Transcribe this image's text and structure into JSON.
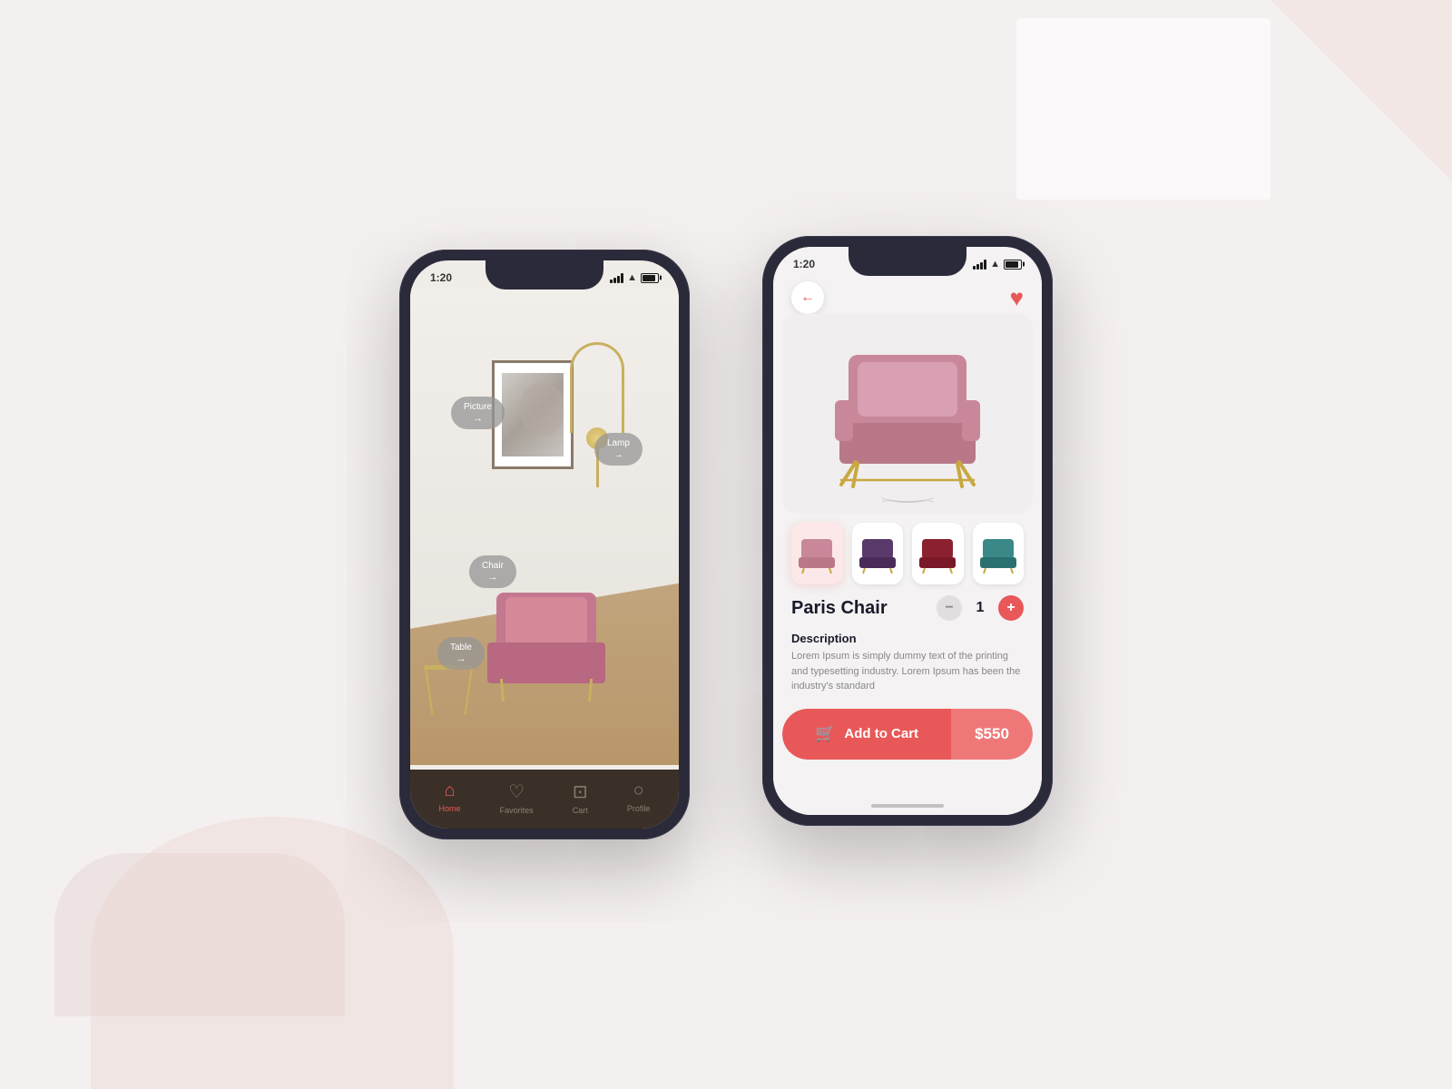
{
  "background": {
    "color": "#f5f0f0"
  },
  "phone1": {
    "status_bar": {
      "time": "1:20",
      "location_icon": "▲"
    },
    "ar_tags": [
      {
        "label": "Picture",
        "id": "picture"
      },
      {
        "label": "Lamp",
        "id": "lamp"
      },
      {
        "label": "Chair",
        "id": "chair"
      },
      {
        "label": "Table",
        "id": "table"
      }
    ],
    "nav_items": [
      {
        "label": "Home",
        "active": true,
        "icon": "⌂"
      },
      {
        "label": "Favorites",
        "active": false,
        "icon": "♡"
      },
      {
        "label": "Cart",
        "active": false,
        "icon": "🛒"
      },
      {
        "label": "Profile",
        "active": false,
        "icon": "👤"
      }
    ]
  },
  "phone2": {
    "status_bar": {
      "time": "1:20",
      "location_icon": "▲"
    },
    "header": {
      "back_label": "←",
      "heart_label": "♥"
    },
    "product": {
      "name": "Paris Chair",
      "description_title": "Description",
      "description_text": "Lorem Ipsum is simply dummy text of the printing and typesetting industry. Lorem Ipsum has been the industry's standard",
      "quantity": 1,
      "price": "$550"
    },
    "colors": [
      {
        "id": "pink",
        "selected": true,
        "color": "#c47890"
      },
      {
        "id": "purple",
        "selected": false,
        "color": "#5a3a5a"
      },
      {
        "id": "red",
        "selected": false,
        "color": "#8a2030"
      },
      {
        "id": "teal",
        "selected": false,
        "color": "#3a8888"
      }
    ],
    "add_to_cart": {
      "label": "Add to Cart",
      "price": "$550"
    }
  }
}
